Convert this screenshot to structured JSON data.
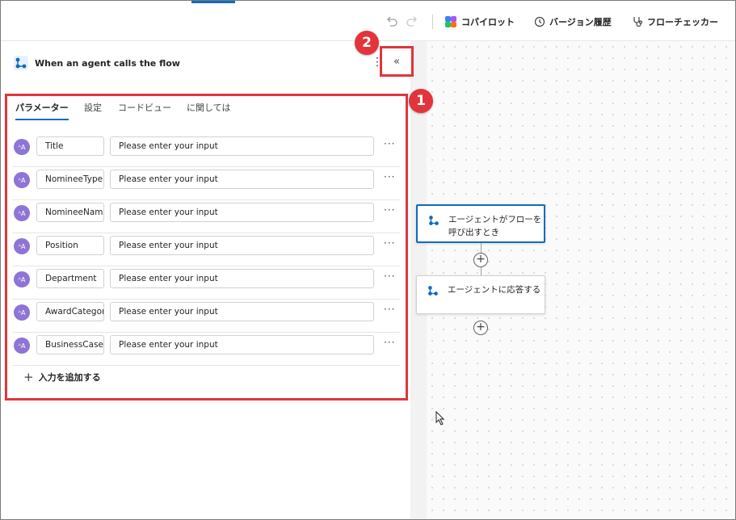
{
  "toolbar": {
    "copilot_label": "コパイロット",
    "version_history_label": "バージョン履歴",
    "flow_checker_label": "フローチェッカー",
    "icons": [
      "undo-icon",
      "redo-icon",
      "copilot-icon",
      "history-icon",
      "stethoscope-icon"
    ]
  },
  "panel": {
    "title": "When an agent calls the flow",
    "more_label": "⋮",
    "collapse_label": "«",
    "tabs": [
      {
        "label": "パラメーター",
        "active": true
      },
      {
        "label": "設定",
        "active": false
      },
      {
        "label": "コードビュー",
        "active": false
      },
      {
        "label": "に関しては",
        "active": false
      }
    ],
    "params": [
      {
        "type_icon": "ᴬA",
        "name": "Title",
        "value": "Please enter your input",
        "more": "···"
      },
      {
        "type_icon": "ᴬA",
        "name": "NomineeType",
        "value": "Please enter your input",
        "more": "···"
      },
      {
        "type_icon": "ᴬA",
        "name": "NomineeName",
        "value": "Please enter your input",
        "more": "···"
      },
      {
        "type_icon": "ᴬA",
        "name": "Position",
        "value": "Please enter your input",
        "more": "···"
      },
      {
        "type_icon": "ᴬA",
        "name": "Department",
        "value": "Please enter your input",
        "more": "···"
      },
      {
        "type_icon": "ᴬA",
        "name": "AwardCategory",
        "value": "Please enter your input",
        "more": "···"
      },
      {
        "type_icon": "ᴬA",
        "name": "BusinessCase",
        "value": "Please enter your input",
        "more": "···"
      }
    ],
    "add_input_label": "入力を追加する",
    "add_input_plus": "+"
  },
  "callouts": {
    "badge_1": "1",
    "badge_2": "2",
    "color": "#e3343b"
  },
  "canvas": {
    "nodes": [
      {
        "label": "エージェントがフローを呼び出すとき",
        "selected": true
      },
      {
        "label": "エージェントに応答する",
        "selected": false
      }
    ],
    "add_step_label": "+"
  },
  "colors": {
    "accent": "#0f6cbd",
    "avatar": "#8e74d6"
  }
}
